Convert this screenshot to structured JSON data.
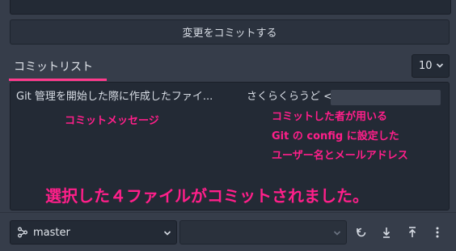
{
  "commit_button": {
    "label": "変更をコミットする"
  },
  "commit_list": {
    "title": "コミットリスト",
    "count_selected": "10",
    "commits": [
      {
        "message": "Git 管理を開始した際に作成したファイ...",
        "author": "さくらくらうど <"
      }
    ]
  },
  "annotations": {
    "message": "コミットメッセージ",
    "config_line1": "コミットした者が用いる",
    "config_line2": "Git の config に設定した",
    "config_line3": "ユーザー名とメールアドレス",
    "result": "選択した４ファイルがコミットされました。"
  },
  "bottom_bar": {
    "branch": "master",
    "icons": [
      "branch-icon",
      "refresh-icon",
      "pull-icon",
      "push-icon",
      "more-icon"
    ]
  },
  "colors": {
    "annotation": "#ff1f8a",
    "tab_underline": "#ff3a8c"
  }
}
